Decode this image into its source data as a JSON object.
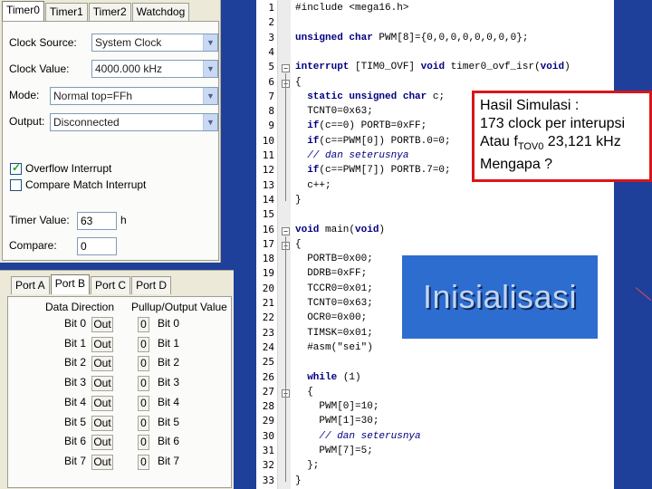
{
  "timer_window": {
    "tabs": [
      "Timer0",
      "Timer1",
      "Timer2",
      "Watchdog"
    ],
    "clock_source_label": "Clock Source:",
    "clock_source_value": "System Clock",
    "clock_value_label": "Clock Value:",
    "clock_value_value": "4000.000 kHz",
    "mode_label": "Mode:",
    "mode_value": "Normal top=FFh",
    "output_label": "Output:",
    "output_value": "Disconnected",
    "overflow_label": "Overflow Interrupt",
    "overflow_checked": true,
    "compare_match_label": "Compare Match Interrupt",
    "compare_match_checked": false,
    "timer_value_label": "Timer Value:",
    "timer_value": "63",
    "timer_unit": "h",
    "compare_label": "Compare:",
    "compare_value": "0"
  },
  "port_window": {
    "tabs": [
      "Port A",
      "Port B",
      "Port C",
      "Port D"
    ],
    "active_tab": "Port B",
    "data_direction_header": "Data Direction",
    "pullup_header": "Pullup/Output Value",
    "rows": [
      {
        "bit": "Bit 0",
        "dir": "Out",
        "val": "0",
        "bit2": "Bit 0"
      },
      {
        "bit": "Bit 1",
        "dir": "Out",
        "val": "0",
        "bit2": "Bit 1"
      },
      {
        "bit": "Bit 2",
        "dir": "Out",
        "val": "0",
        "bit2": "Bit 2"
      },
      {
        "bit": "Bit 3",
        "dir": "Out",
        "val": "0",
        "bit2": "Bit 3"
      },
      {
        "bit": "Bit 4",
        "dir": "Out",
        "val": "0",
        "bit2": "Bit 4"
      },
      {
        "bit": "Bit 5",
        "dir": "Out",
        "val": "0",
        "bit2": "Bit 5"
      },
      {
        "bit": "Bit 6",
        "dir": "Out",
        "val": "0",
        "bit2": "Bit 6"
      },
      {
        "bit": "Bit 7",
        "dir": "Out",
        "val": "0",
        "bit2": "Bit 7"
      }
    ]
  },
  "editor": {
    "lines": [
      {
        "n": "1",
        "text": "#include <mega16.h>"
      },
      {
        "n": "2",
        "text": ""
      },
      {
        "n": "3",
        "text": "unsigned char PWM[8]={0,0,0,0,0,0,0,0};"
      },
      {
        "n": "4",
        "text": ""
      },
      {
        "n": "5",
        "text": "interrupt [TIM0_OVF] void timer0_ovf_isr(void)"
      },
      {
        "n": "6",
        "text": "{"
      },
      {
        "n": "7",
        "text": "  static unsigned char c;"
      },
      {
        "n": "8",
        "text": "  TCNT0=0x63;"
      },
      {
        "n": "9",
        "text": "  if(c==0) PORTB=0xFF;"
      },
      {
        "n": "10",
        "text": "  if(c==PWM[0]) PORTB.0=0;"
      },
      {
        "n": "11",
        "text": "  // dan seterusnya"
      },
      {
        "n": "12",
        "text": "  if(c==PWM[7]) PORTB.7=0;"
      },
      {
        "n": "13",
        "text": "  c++;"
      },
      {
        "n": "14",
        "text": "}"
      },
      {
        "n": "15",
        "text": ""
      },
      {
        "n": "16",
        "text": "void main(void)"
      },
      {
        "n": "17",
        "text": "{"
      },
      {
        "n": "18",
        "text": "  PORTB=0x00;"
      },
      {
        "n": "19",
        "text": "  DDRB=0xFF;"
      },
      {
        "n": "20",
        "text": "  TCCR0=0x01;"
      },
      {
        "n": "21",
        "text": "  TCNT0=0x63;"
      },
      {
        "n": "22",
        "text": "  OCR0=0x00;"
      },
      {
        "n": "23",
        "text": "  TIMSK=0x01;"
      },
      {
        "n": "24",
        "text": "  #asm(\"sei\")"
      },
      {
        "n": "25",
        "text": ""
      },
      {
        "n": "26",
        "text": "  while (1)"
      },
      {
        "n": "27",
        "text": "  {"
      },
      {
        "n": "28",
        "text": "    PWM[0]=10;"
      },
      {
        "n": "29",
        "text": "    PWM[1]=30;"
      },
      {
        "n": "30",
        "text": "    // dan seterusnya"
      },
      {
        "n": "31",
        "text": "    PWM[7]=5;"
      },
      {
        "n": "32",
        "text": "  };"
      },
      {
        "n": "33",
        "text": "}"
      }
    ]
  },
  "callout": {
    "line1": "Hasil Simulasi :",
    "line2": "173 clock per interupsi",
    "line3_prefix": "Atau f",
    "line3_sub": "TOV0",
    "line3_suffix": " 23,121 kHz",
    "line4": "Mengapa ?"
  },
  "inisialisasi_label": "Inisialisasi",
  "colors": {
    "background": "#1e3f9a",
    "callout_border": "#d9151b",
    "inisialisasi_bg": "#2d6dd0"
  }
}
